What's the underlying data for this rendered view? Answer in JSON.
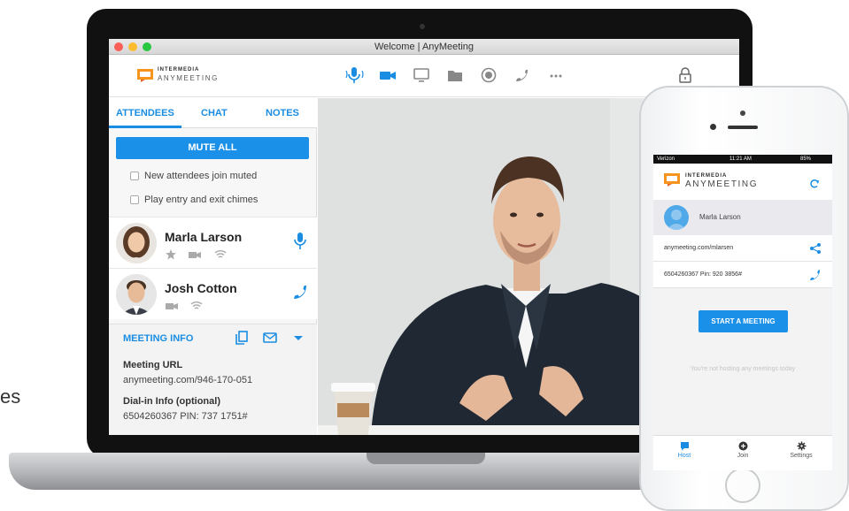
{
  "edge_text": "es",
  "window": {
    "title": "Welcome | AnyMeeting"
  },
  "brand": {
    "line1": "INTERMEDIA",
    "line2": "ANYMEETING"
  },
  "toolbar": {
    "tools": [
      "microphone-icon",
      "video-camera-icon",
      "screen-share-icon",
      "folder-icon",
      "record-icon",
      "phone-icon",
      "more-icon"
    ],
    "lock_icon": "lock-icon",
    "accent": "#1a8de3"
  },
  "sidebar": {
    "tabs": [
      {
        "label": "ATTENDEES",
        "active": true
      },
      {
        "label": "CHAT",
        "active": false
      },
      {
        "label": "NOTES",
        "active": false
      }
    ],
    "mute_all_label": "MUTE ALL",
    "options": [
      {
        "label": "New attendees join muted",
        "checked": false
      },
      {
        "label": "Play entry and exit chimes",
        "checked": false
      }
    ],
    "attendees": [
      {
        "name": "Marla Larson",
        "status_icons": [
          "star-icon",
          "video-camera-icon",
          "wifi-icon"
        ],
        "action_icon": "microphone-icon"
      },
      {
        "name": "Josh  Cotton",
        "status_icons": [
          "video-camera-icon",
          "wifi-icon"
        ],
        "action_icon": "phone-icon"
      }
    ],
    "meeting_info": {
      "title": "MEETING INFO",
      "url_label": "Meeting URL",
      "url_value": "anymeeting.com/946-170-051",
      "dial_label": "Dial-in Info (optional)",
      "dial_value": "6504260367 PIN: 737 1751#"
    }
  },
  "phone": {
    "status": {
      "carrier": "Verizon",
      "time": "11:21 AM",
      "battery": "85%"
    },
    "brand": {
      "line1": "INTERMEDIA",
      "line2": "ANYMEETING"
    },
    "user_name": "Marla Larson",
    "meeting_url": "anymeeting.com/mlarsen",
    "dial_info": "6504260367 Pin: 920 3856#",
    "start_label": "START A MEETING",
    "empty_text": "You're not hosting any meetings today",
    "tabs": [
      {
        "label": "Host",
        "icon": "chat-bubble-icon",
        "active": true
      },
      {
        "label": "Join",
        "icon": "add-circle-icon",
        "active": false
      },
      {
        "label": "Settings",
        "icon": "gear-icon",
        "active": false
      }
    ]
  }
}
